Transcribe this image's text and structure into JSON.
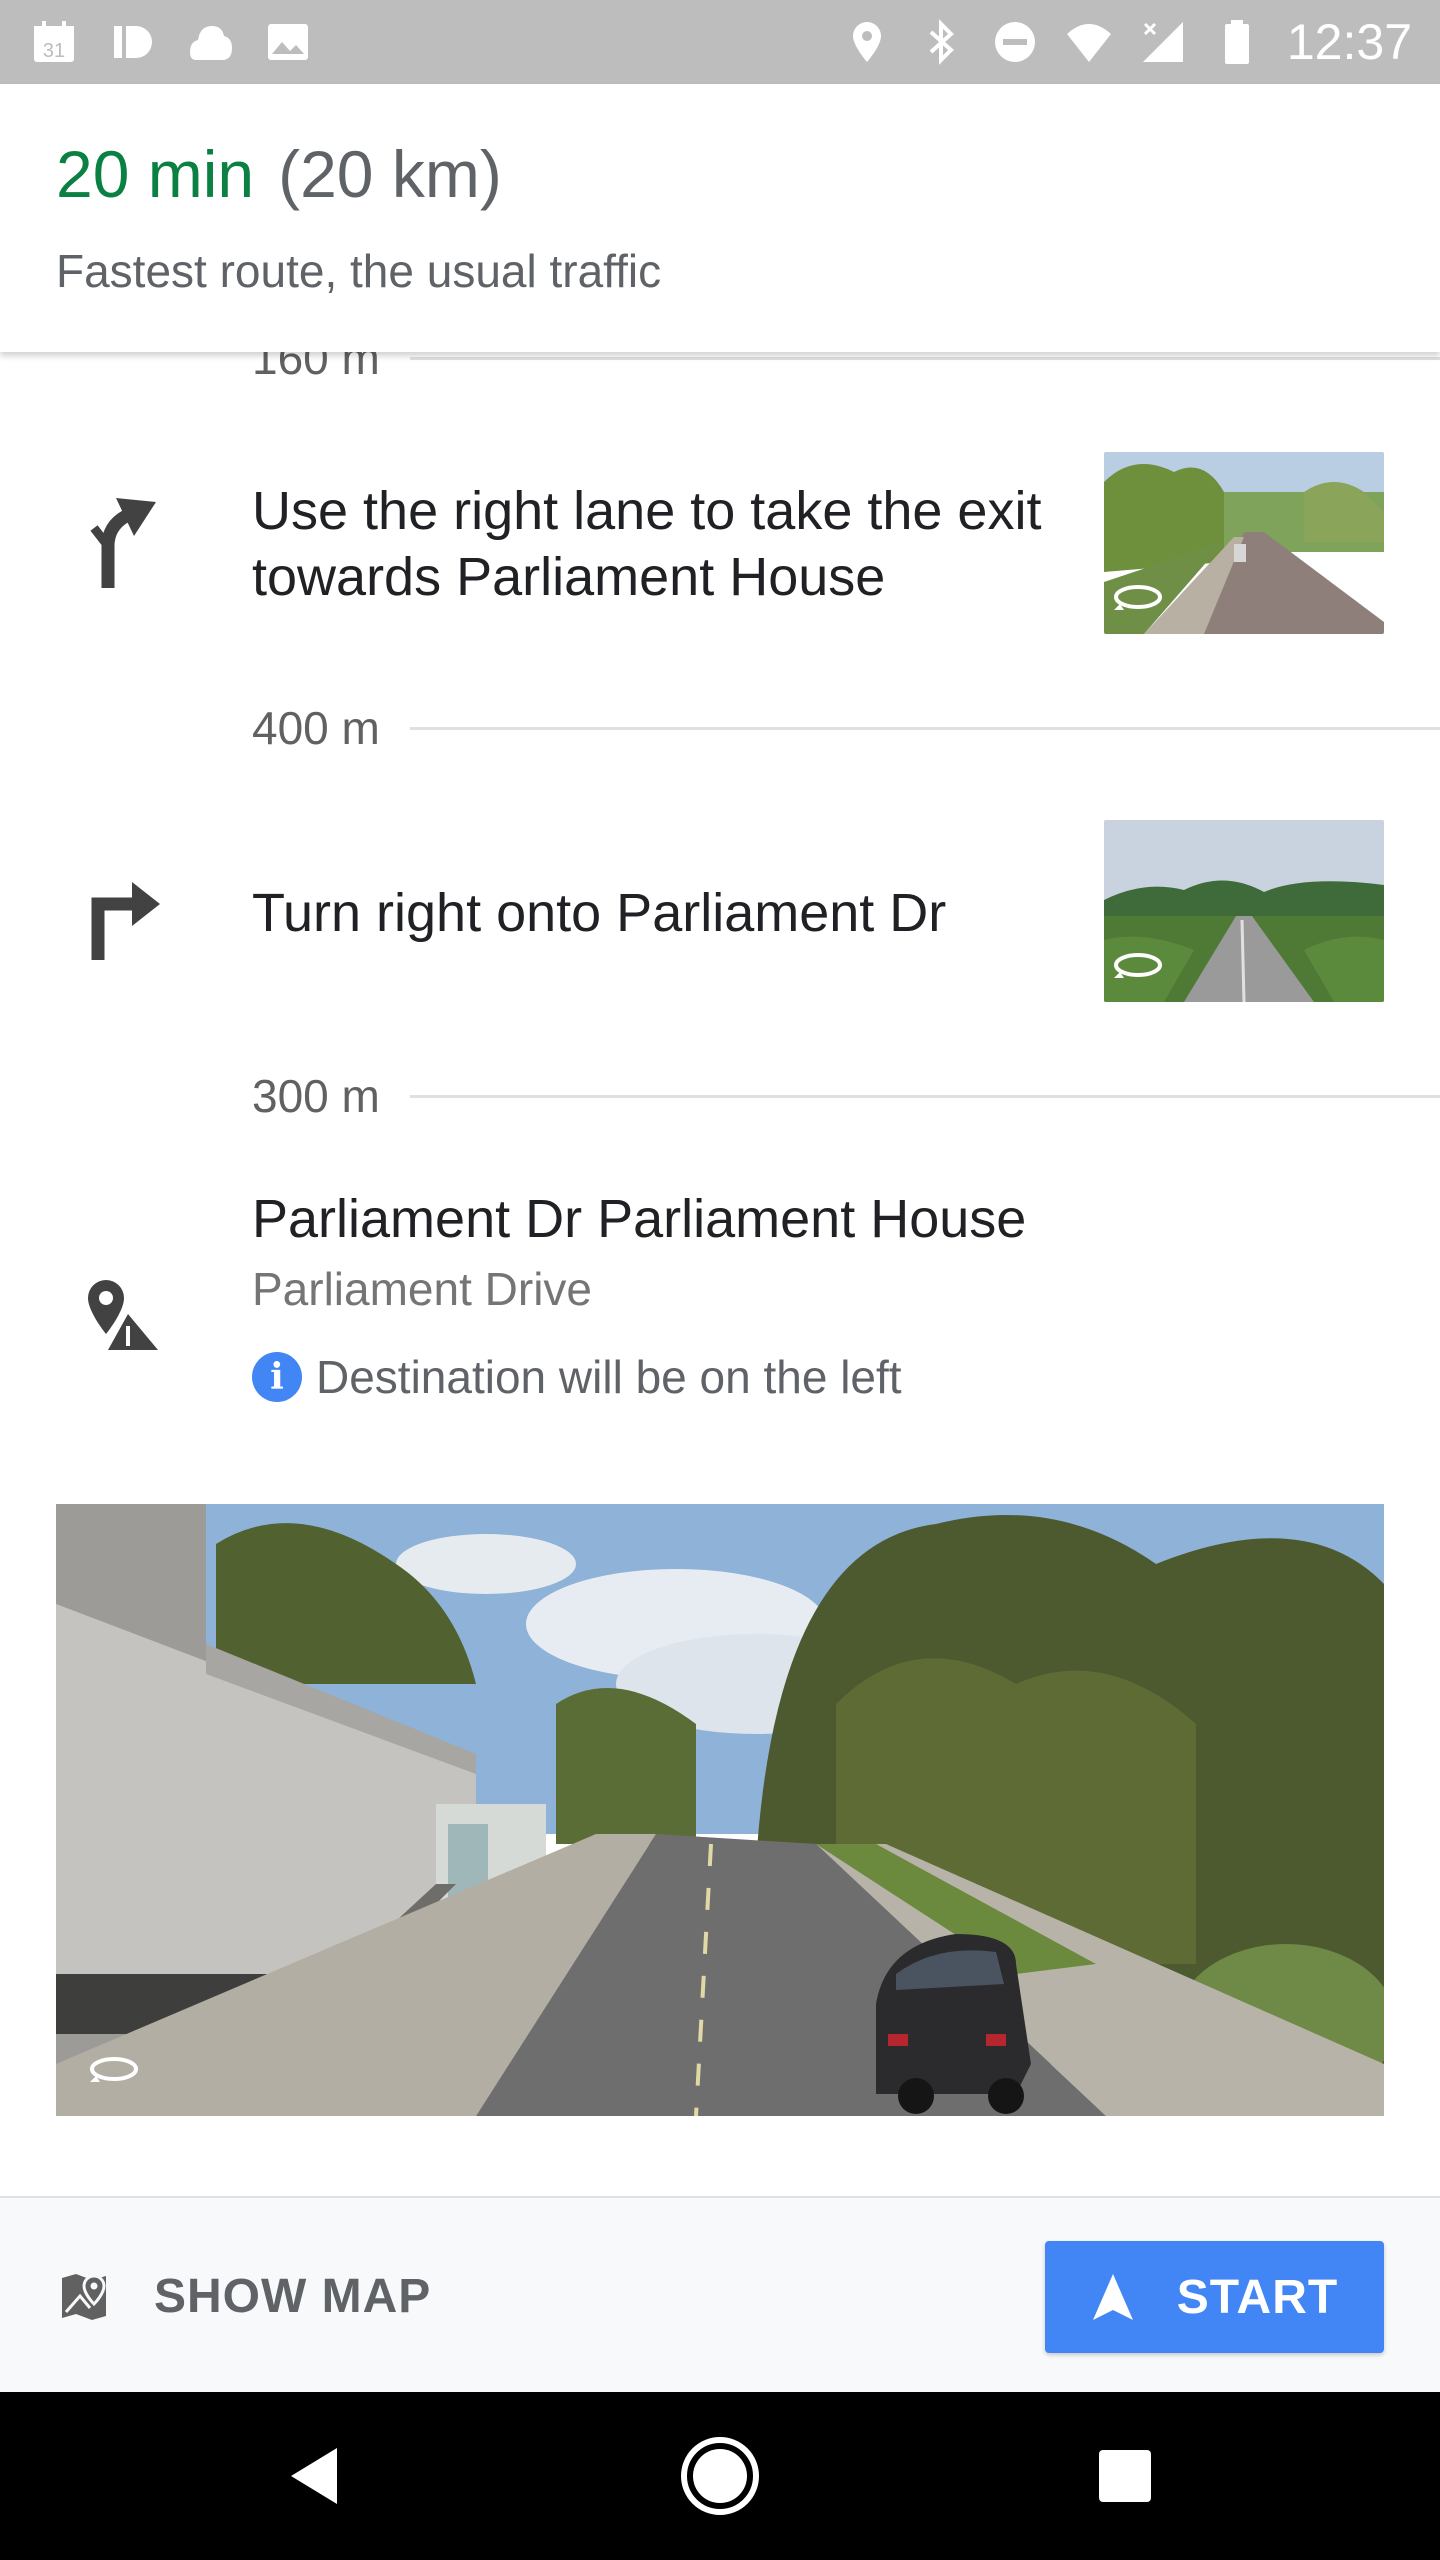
{
  "status_bar": {
    "time": "12:37",
    "calendar_day": "31",
    "left_icons": [
      "calendar-icon",
      "id-icon",
      "cloud-icon",
      "image-icon"
    ],
    "right_icons": [
      "location-icon",
      "bluetooth-icon",
      "dnd-icon",
      "wifi-icon",
      "signal-icon",
      "battery-icon"
    ]
  },
  "header": {
    "eta_time": "20 min",
    "eta_distance": "(20 km)",
    "route_description": "Fastest route, the usual traffic"
  },
  "steps": {
    "partial_distance": "160 m",
    "items": [
      {
        "instruction": "Use the right lane to take the exit towards Parliament House",
        "icon": "slight-left-exit-icon",
        "distance_after": "400 m"
      },
      {
        "instruction": "Turn right onto Parliament Dr",
        "icon": "turn-right-icon",
        "distance_after": "300 m"
      }
    ],
    "destination": {
      "title": "Parliament Dr Parliament House",
      "subtitle": "Parliament Drive",
      "note": "Destination will be on the left",
      "icon": "destination-pin-icon"
    }
  },
  "action_bar": {
    "show_map_label": "SHOW MAP",
    "start_label": "START"
  },
  "colors": {
    "eta_green": "#0b8043",
    "start_blue": "#4285f4",
    "status_bar": "#bdbdbd"
  }
}
